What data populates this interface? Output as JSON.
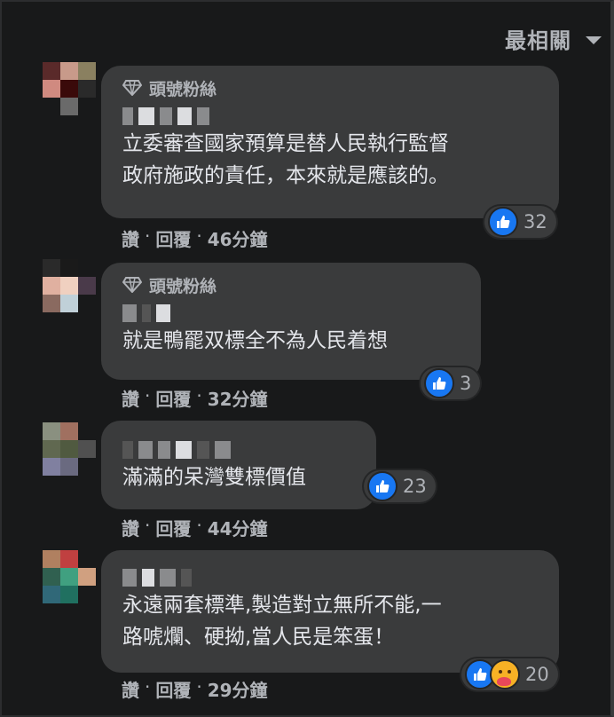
{
  "header": {
    "sort_label": "最相關"
  },
  "comments": [
    {
      "badge": "頭號粉絲",
      "text": "立委審查國家預算是替人民執行監督\n政府施政的責任，本來就是應該的。",
      "actions": {
        "like": "讚",
        "reply": "回覆",
        "time": "46分鐘"
      },
      "reactions": {
        "count": "32",
        "types": [
          "like"
        ]
      }
    },
    {
      "badge": "頭號粉絲",
      "text": "就是鴨罷双標全不為人民着想",
      "actions": {
        "like": "讚",
        "reply": "回覆",
        "time": "32分鐘"
      },
      "reactions": {
        "count": "3",
        "types": [
          "like"
        ]
      }
    },
    {
      "text": "滿滿的呆灣雙標價值",
      "actions": {
        "like": "讚",
        "reply": "回覆",
        "time": "44分鐘"
      },
      "reactions": {
        "count": "23",
        "types": [
          "like"
        ]
      }
    },
    {
      "text": "永遠兩套標準,製造對立無所不能,一\n路唬爛、硬拗,當人民是笨蛋！",
      "actions": {
        "like": "讚",
        "reply": "回覆",
        "time": "29分鐘"
      },
      "reactions": {
        "count": "20",
        "types": [
          "like",
          "care"
        ]
      }
    }
  ],
  "colors": {
    "background": "#18191a",
    "bubble": "#3a3b3c",
    "like_blue": "#1877f2",
    "secondary_text": "#b0b3b8"
  }
}
